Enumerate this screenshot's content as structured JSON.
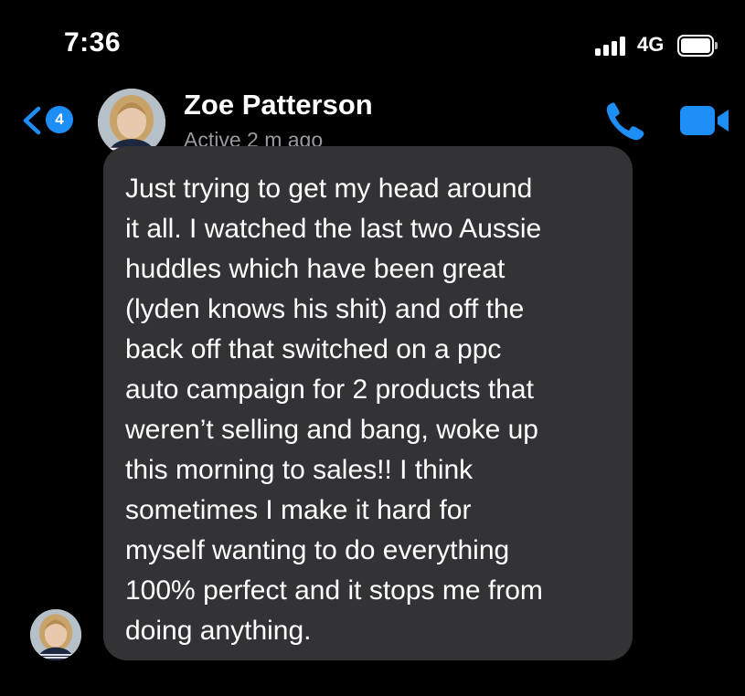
{
  "status_bar": {
    "time": "7:36",
    "network": "4G",
    "signal_bars": 4,
    "battery_level": 1.0
  },
  "header": {
    "back_icon": "chevron-left-icon",
    "unread_count": "4",
    "contact_name": "Zoe Patterson",
    "contact_status": "Active 2 m ago",
    "call_icon": "phone-icon",
    "video_icon": "video-camera-icon",
    "accent_color": "#1e8ef7"
  },
  "conversation": {
    "messages": [
      {
        "direction": "incoming",
        "text": "Just trying to get my head around\nit all. I watched the last two Aussie\nhuddles which have been great\n(lyden knows his shit) and off the\nback off that switched on a ppc\nauto campaign for 2 products that\nweren’t selling and bang, woke up\nthis morning to sales!! I think\nsometimes I make it hard for\nmyself wanting to do everything\n100% perfect and it stops me from\ndoing anything.",
        "bubble_color": "#333336"
      }
    ]
  }
}
